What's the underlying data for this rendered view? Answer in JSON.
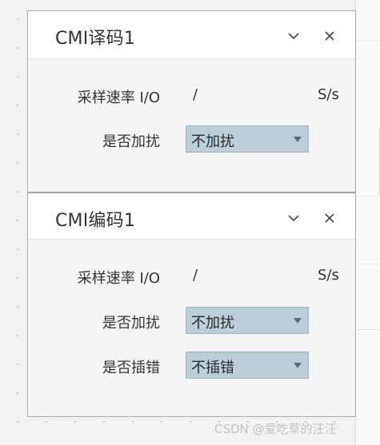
{
  "dialogs": {
    "decode": {
      "title": "CMI译码1",
      "rows": {
        "rate": {
          "label": "采样速率 I/O",
          "value": "/",
          "unit": "S/s"
        },
        "jitter": {
          "label": "是否加扰",
          "selected": "不加扰"
        }
      }
    },
    "encode": {
      "title": "CMI编码1",
      "rows": {
        "rate": {
          "label": "采样速率 I/O",
          "value": "/",
          "unit": "S/s"
        },
        "jitter": {
          "label": "是否加扰",
          "selected": "不加扰"
        },
        "error": {
          "label": "是否插错",
          "selected": "不插错"
        }
      }
    }
  },
  "icons": {
    "collapse": "chevron-down-icon",
    "close": "close-icon",
    "dropdown": "triangle-down-icon"
  },
  "colors": {
    "select_bg": "#bccfd8",
    "dialog_bg": "#f5f5f5",
    "header_bg": "#ffffff"
  },
  "watermark": "CSDN @爱吃草的汪汪"
}
